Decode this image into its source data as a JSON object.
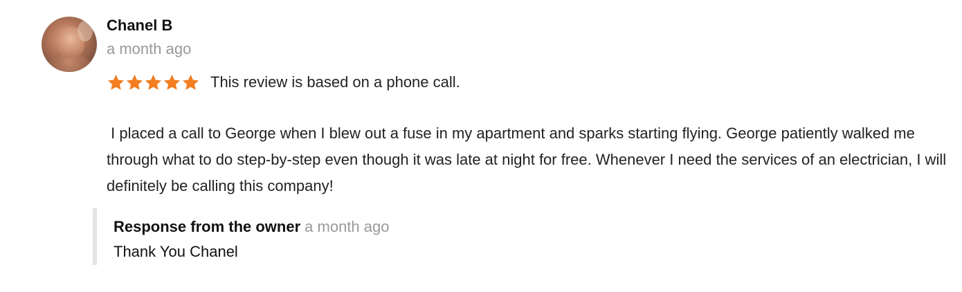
{
  "review": {
    "author_name": "Chanel B",
    "time": "a month ago",
    "rating": 5,
    "rating_max": 5,
    "star_color": "#f37d20",
    "rating_note": "This review is based on a phone call.",
    "body": " I placed a call to George when I blew out a fuse in my apartment and sparks starting flying. George patiently walked me through what to do step-by-step even though it was late at night for free. Whenever I need the services of an electrician, I will definitely be calling this company!"
  },
  "owner_response": {
    "label": "Response from the owner",
    "time": "a month ago",
    "text": "Thank You Chanel"
  },
  "icons": {
    "avatar": "user-photo",
    "star": "star-icon"
  }
}
